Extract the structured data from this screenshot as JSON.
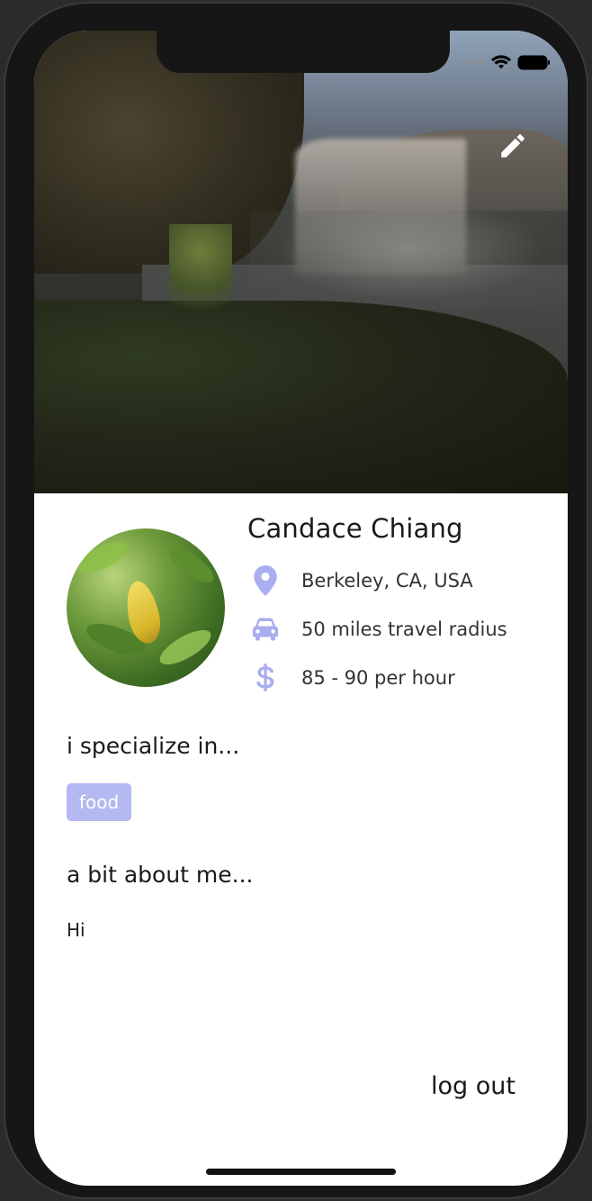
{
  "profile": {
    "name": "Candace Chiang",
    "location": "Berkeley, CA, USA",
    "travel_radius": "50 miles travel radius",
    "rate": "85 - 90 per hour"
  },
  "sections": {
    "specialize_heading": "i specialize in...",
    "specialties": [
      "food"
    ],
    "about_heading": "a bit about me...",
    "about_text": "Hi"
  },
  "actions": {
    "logout_label": "log out"
  },
  "icons": {
    "edit": "pencil-icon",
    "location": "map-pin-icon",
    "radius": "car-icon",
    "rate": "dollar-icon",
    "wifi": "wifi-icon",
    "battery": "battery-icon"
  },
  "colors": {
    "accent": "#b5b9f1",
    "icon": "#a9aef0",
    "text": "#1a1a1a"
  }
}
